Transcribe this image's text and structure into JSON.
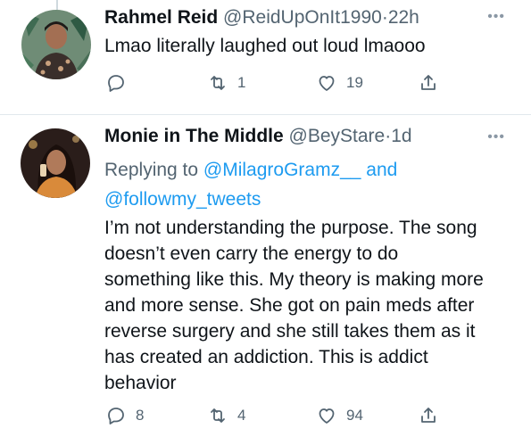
{
  "tweets": [
    {
      "name": "Rahmel Reid",
      "handle": "@ReidUpOnIt1990",
      "separator": "·",
      "time": "22h",
      "more": "•••",
      "text": "Lmao literally laughed out loud lmaooo",
      "actions": {
        "replies": "",
        "retweets": "1",
        "likes": "19"
      }
    },
    {
      "name": "Monie in The Middle",
      "handle": "@BeyStare",
      "separator": "·",
      "time": "1d",
      "more": "•••",
      "reply_prefix": "Replying to",
      "reply_user1": "@MilagroGramz__",
      "reply_and": "and",
      "reply_user2": "@followmy_tweets",
      "text": "I’m not understanding the purpose. The song doesn’t even carry the energy to do something like this. My theory is making more and more sense. She got on pain meds after reverse surgery and she still takes them as it has created an addiction. This is addict behavior",
      "actions": {
        "replies": "8",
        "retweets": "4",
        "likes": "94"
      }
    }
  ],
  "icons": {
    "reply": "reply-icon",
    "retweet": "retweet-icon",
    "like": "heart-icon",
    "share": "share-icon",
    "more": "more-icon"
  },
  "colors": {
    "text": "#0f1419",
    "secondary": "#536471",
    "link": "#1d9bf0",
    "divider": "#e1e8ed"
  }
}
